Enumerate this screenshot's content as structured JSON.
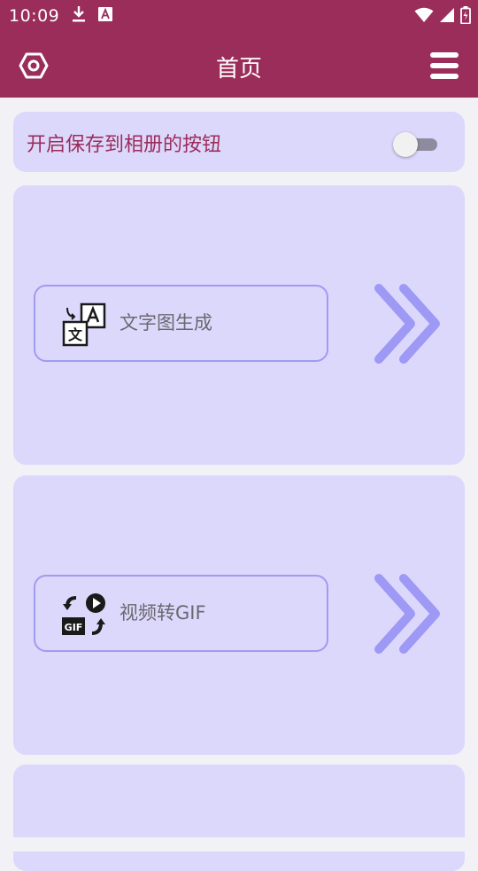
{
  "status_bar": {
    "time": "10:09",
    "left_icons": [
      "download-icon",
      "a-notification-icon"
    ],
    "right_icons": [
      "wifi-icon",
      "signal-icon",
      "battery-icon"
    ]
  },
  "app_bar": {
    "title": "首页",
    "left_icon": "settings-hexagon-icon",
    "right_icon": "menu-icon",
    "background": "#9b2d5a"
  },
  "toggle_setting": {
    "label": "开启保存到相册的按钮",
    "enabled": false
  },
  "features": [
    {
      "label": "文字图生成",
      "icon": "text-translate-icon",
      "arrow": "double-chevron-right-icon"
    },
    {
      "label": "视频转GIF",
      "icon": "video-to-gif-icon",
      "arrow": "double-chevron-right-icon"
    }
  ],
  "colors": {
    "accent": "#9b2d5a",
    "card": "#dcd8fc",
    "button_border": "#a09bf0",
    "chevron": "#8e89f2",
    "label": "#6b6870"
  }
}
